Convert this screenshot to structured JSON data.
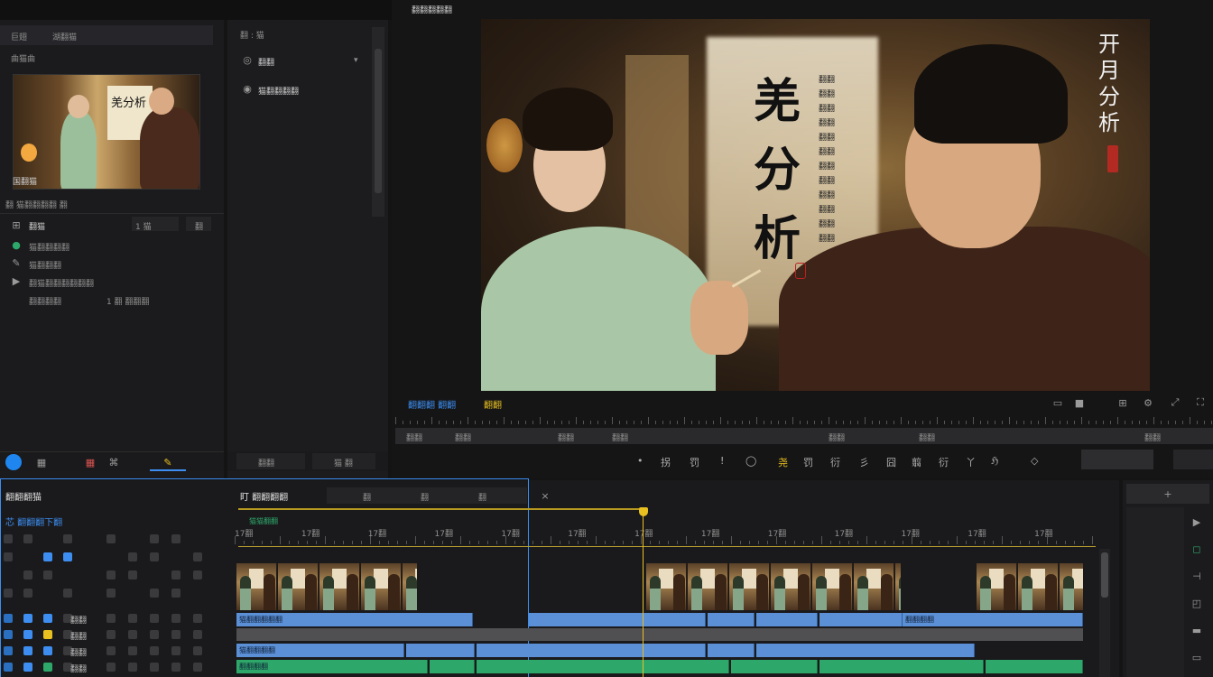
{
  "colors": {
    "accent_blue": "#3d8ef0",
    "clip_blue": "#5b8fd6",
    "clip_green": "#2ea86a",
    "playhead": "#e8c020"
  },
  "media_panel": {
    "tabs": [
      "巨翅",
      "湖翻猫"
    ],
    "header": "曲猫曲",
    "thumb_title": "羌分析",
    "thumb_caption": "国翻猫",
    "section_title": "翻 猫翻翻翻翻 翻",
    "props": [
      {
        "label": "翻猫",
        "value": "1 猫",
        "value2": "翻"
      },
      {
        "label": "猫翻翻翻翻"
      },
      {
        "label": "猫翻翻翻"
      },
      {
        "label": "翻猫翻翻翻翻翻翻"
      },
      {
        "label": "翻翻翻翻",
        "value": "1 翻 翻翻翻"
      }
    ],
    "bottom_icons": [
      "home-icon",
      "film-icon",
      "red-icon",
      "grid-icon",
      "brush-icon"
    ]
  },
  "effects_panel": {
    "header": "翻 : 猫",
    "items": [
      "翻翻",
      "猫翻翻翻翻"
    ],
    "footer_left": "翻翻",
    "footer_right": "猫 翻"
  },
  "preview": {
    "top_label": "翻翻翻翻翻",
    "title": "羌分析",
    "small_text": "翻翻翻翻\n翻翻翻翻\n翻翻翻翻\n翻翻翻翻\n翻翻翻翻\n翻翻翻翻",
    "right_title": "开月分析",
    "timecode": "翻翻翻 翻翻",
    "timecode2": "翻翻"
  },
  "transport": {
    "ruler_labels": [
      "翻翻",
      "翻翻",
      "翻翻",
      "翻翻",
      "翻翻",
      "翻翻",
      "翻翻"
    ],
    "tools": [
      "•",
      "拐",
      "罚",
      "!",
      "◯",
      "尧",
      "罚",
      "衍",
      "彡",
      "囧",
      "翦",
      "衍",
      "丫",
      "ℌ",
      "◇"
    ]
  },
  "timeline": {
    "title": "翻翻翻猫",
    "subtitle": "芯 翻翻翻下翻",
    "sequence_name": "盯 翻翻翻翻",
    "in_out": [
      "翻",
      "翻",
      "翻"
    ],
    "tracks_label": "猫猫翻翻",
    "ruler": [
      "17翻",
      "17翻",
      "17翻",
      "17翻",
      "17翻",
      "17翻",
      "17翻",
      "17翻",
      "17翻",
      "17翻",
      "17翻",
      "17翻",
      "17翻"
    ],
    "track_names": [
      "翻翻",
      "翻翻",
      "翻翻",
      "翻翻"
    ],
    "clip_labels": [
      "猫翻翻翻翻翻",
      "翻翻翻翻",
      "猫翻翻翻翻",
      "翻翻翻翻"
    ]
  },
  "right_dock": {
    "tools": [
      "+",
      "▶",
      "◻",
      "⊣",
      "◰",
      "▬",
      "▭"
    ]
  }
}
